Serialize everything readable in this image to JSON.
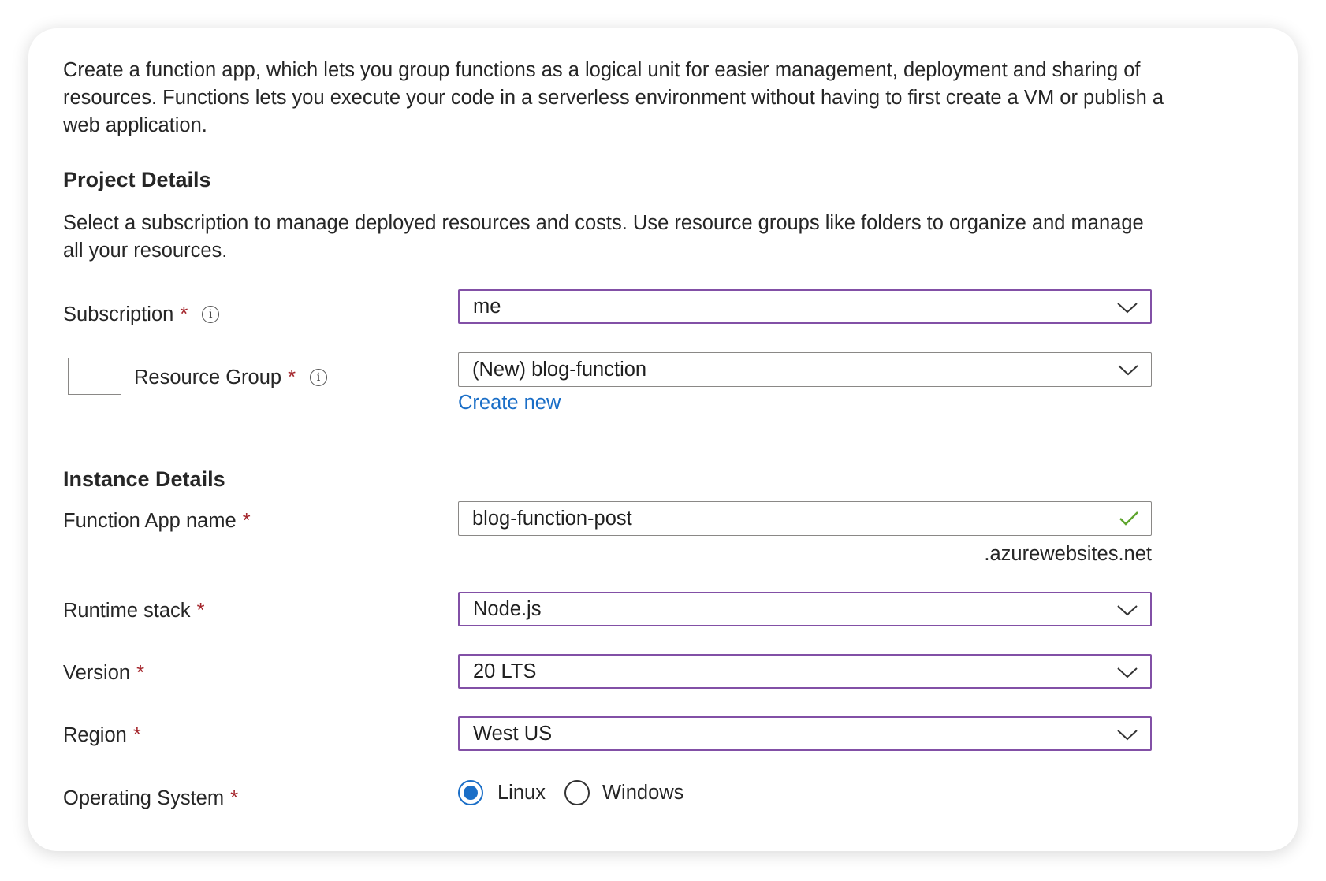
{
  "intro": "Create a function app, which lets you group functions as a logical unit for easier management, deployment and sharing of resources. Functions lets you execute your code in a serverless environment without having to first create a VM or publish a web application.",
  "project": {
    "heading": "Project Details",
    "description": "Select a subscription to manage deployed resources and costs. Use resource groups like folders to organize and manage all your resources.",
    "subscription": {
      "label": "Subscription",
      "required_mark": "*",
      "value": "me"
    },
    "resource_group": {
      "label": "Resource Group",
      "required_mark": "*",
      "value": "(New) blog-function",
      "create_new": "Create new"
    }
  },
  "instance": {
    "heading": "Instance Details",
    "app_name": {
      "label": "Function App name",
      "required_mark": "*",
      "value": "blog-function-post",
      "suffix": ".azurewebsites.net"
    },
    "runtime": {
      "label": "Runtime stack",
      "required_mark": "*",
      "value": "Node.js"
    },
    "version": {
      "label": "Version",
      "required_mark": "*",
      "value": "20 LTS"
    },
    "region": {
      "label": "Region",
      "required_mark": "*",
      "value": "West US"
    },
    "os": {
      "label": "Operating System",
      "required_mark": "*",
      "options": [
        "Linux",
        "Windows"
      ],
      "selected": "Linux"
    }
  },
  "colors": {
    "select_border": "#8250a6",
    "link": "#1a6ec7",
    "required": "#a4262c",
    "valid_check": "#5ea52e"
  }
}
